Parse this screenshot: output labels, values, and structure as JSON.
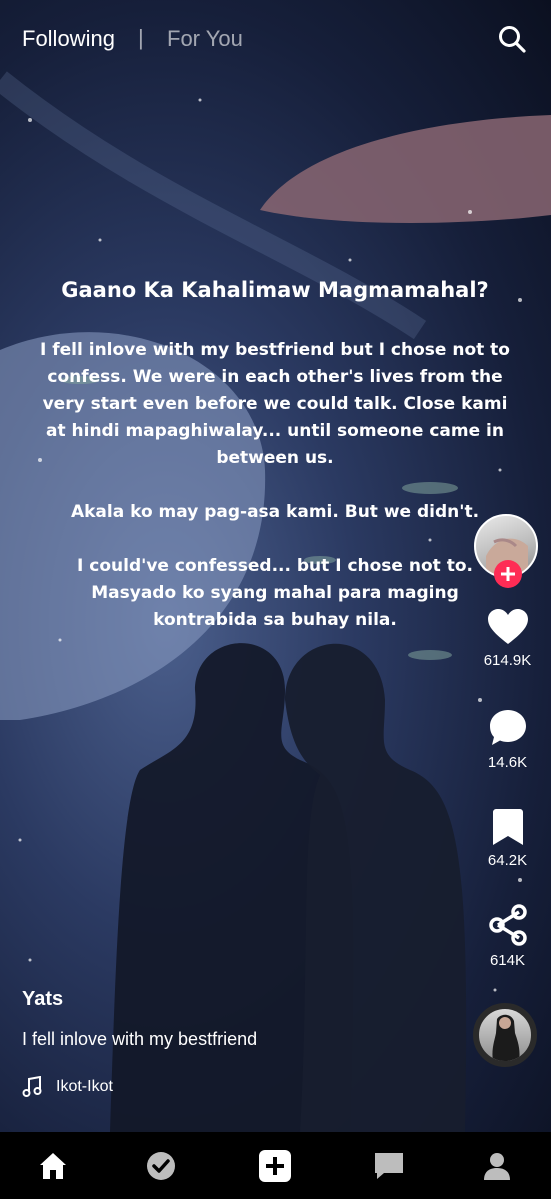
{
  "topbar": {
    "following_label": "Following",
    "separator": "|",
    "for_you_label": "For You",
    "search_icon": "search-icon"
  },
  "overlay": {
    "title": "Gaano Ka Kahalimaw Magmamahal?",
    "paragraphs": [
      "I fell inlove with my bestfriend but I chose not to confess. We were in each other's lives from the very start even before we could talk. Close kami at hindi mapaghiwalay... until someone came in between us.",
      "Akala ko may pag-asa kami. But we didn't.",
      "I could've confessed... but I chose not to. Masyado ko syang mahal para maging kontrabida sa buhay nila."
    ]
  },
  "actions": {
    "follow_icon": "plus-icon",
    "likes": "614.9K",
    "comments": "14.6K",
    "saves": "64.2K",
    "shares": "614K"
  },
  "post": {
    "username": "Yats",
    "description": "I fell inlove with my bestfriend",
    "sound": "Ikot-Ikot"
  },
  "bottom_nav": [
    "home-icon",
    "check-circle-icon",
    "create-icon",
    "inbox-icon",
    "profile-icon"
  ],
  "colors": {
    "accent": "#fe2c55",
    "background": "#000000"
  }
}
